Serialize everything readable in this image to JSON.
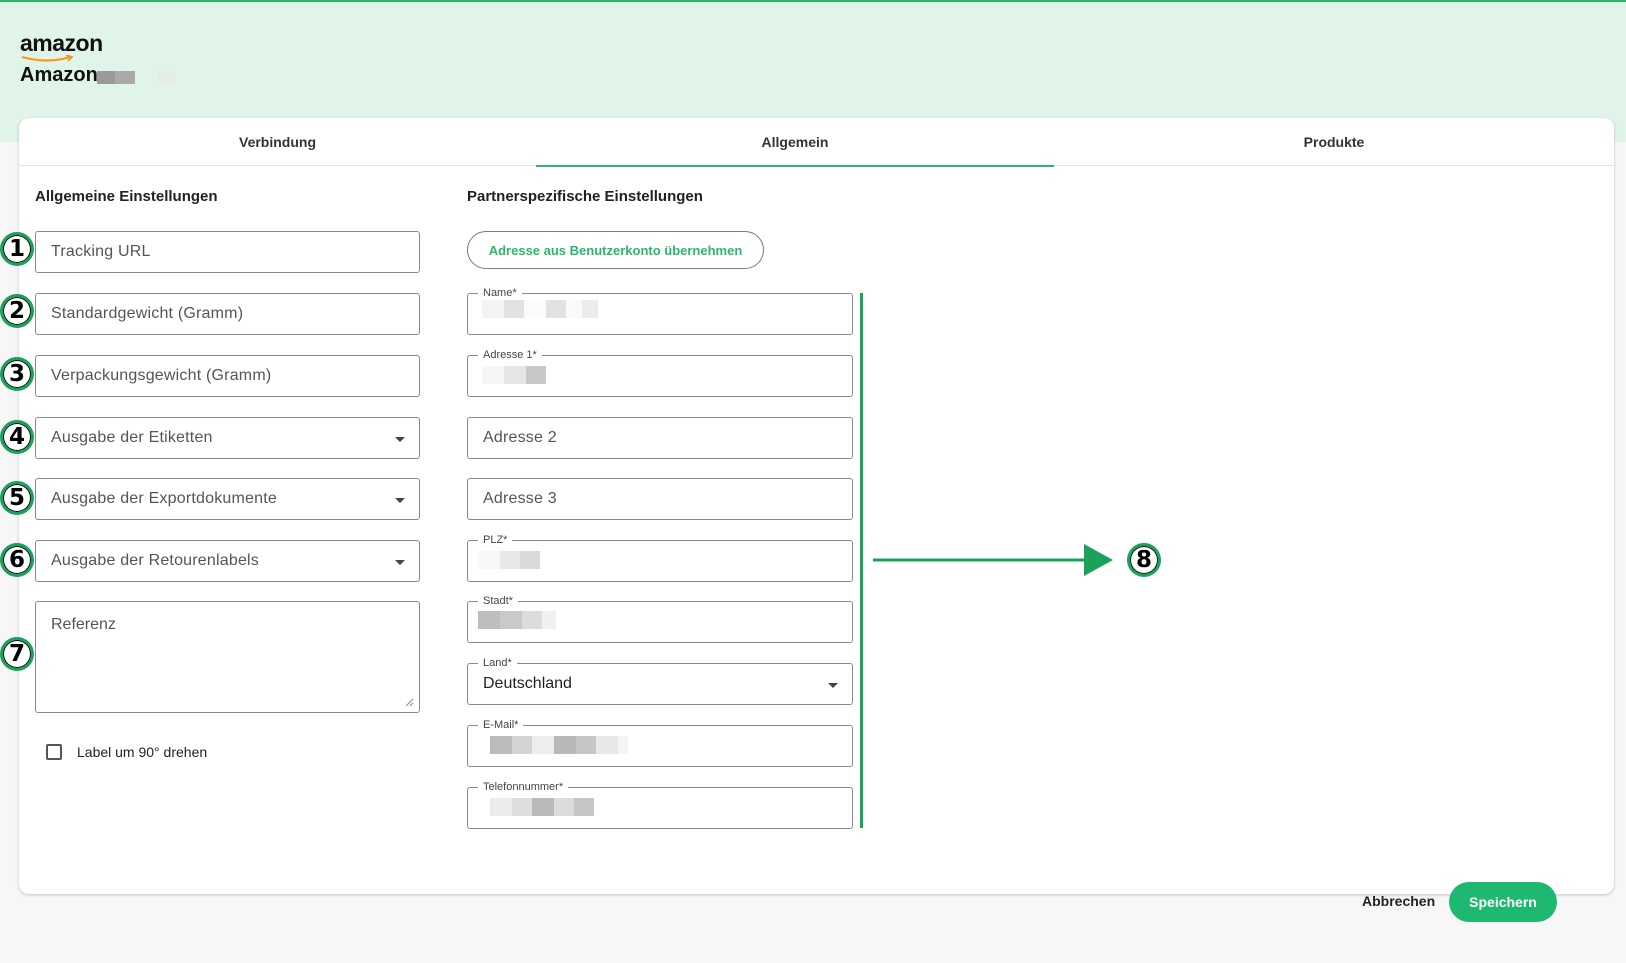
{
  "brand": {
    "logo_text": "amazon",
    "title": "Amazon"
  },
  "tabs": [
    {
      "label": "Verbindung"
    },
    {
      "label": "Allgemein"
    },
    {
      "label": "Produkte"
    }
  ],
  "general": {
    "section_title": "Allgemeine Einstellungen",
    "tracking_url": "Tracking URL",
    "default_weight": "Standardgewicht (Gramm)",
    "packaging_weight": "Verpackungsgewicht (Gramm)",
    "label_output": "Ausgabe der Etiketten",
    "export_docs_output": "Ausgabe der Exportdokumente",
    "return_labels_output": "Ausgabe der Retourenlabels",
    "reference": "Referenz",
    "rotate_label": "Label um 90° drehen"
  },
  "partner": {
    "section_title": "Partnerspezifische Einstellungen",
    "copy_address_button": "Adresse aus Benutzerkonto übernehmen",
    "name_label": "Name*",
    "address1_label": "Adresse 1*",
    "address2_placeholder": "Adresse 2",
    "address3_placeholder": "Adresse 3",
    "zip_label": "PLZ*",
    "city_label": "Stadt*",
    "country_label": "Land*",
    "country_value": "Deutschland",
    "email_label": "E-Mail*",
    "phone_label": "Telefonnummer*"
  },
  "annotations": [
    "1",
    "2",
    "3",
    "4",
    "5",
    "6",
    "7",
    "8"
  ],
  "footer": {
    "cancel": "Abbrechen",
    "save": "Speichern"
  },
  "colors": {
    "accent": "#2db56f",
    "header_bg": "#e1f4ea",
    "annotation_green": "#1aa15a"
  }
}
